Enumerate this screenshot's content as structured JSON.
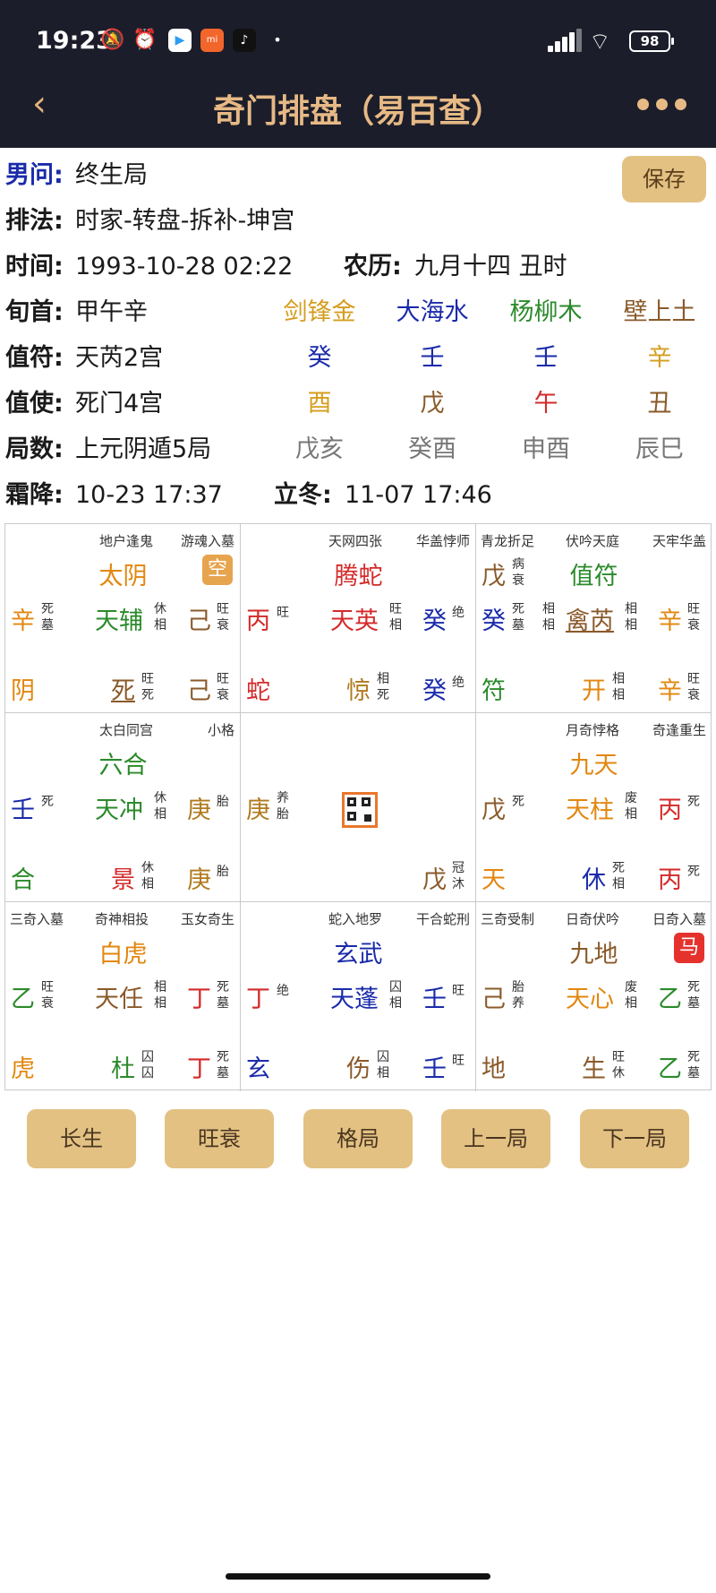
{
  "status_bar": {
    "time": "19:23",
    "battery": "98",
    "app3_glyph": "mi"
  },
  "header": {
    "title": "奇门排盘（易百查）",
    "back_icon": "chevron-left-icon",
    "more_icon": "more-dots-icon"
  },
  "save_label": "保存",
  "info": {
    "gender_label": "男问:",
    "gender_value": "终生局",
    "method_label": "排法:",
    "method_value": "时家-转盘-拆补-坤宫",
    "time_label": "时间:",
    "time_value": "1993-10-28 02:22",
    "lunar_label": "农历:",
    "lunar_value": "九月十四 丑时",
    "xunshou_label": "旬首:",
    "xunshou_value": "甲午辛",
    "nayin": [
      "剑锋金",
      "大海水",
      "杨柳木",
      "壁上土"
    ],
    "zhifu_label": "值符:",
    "zhifu_value": "天芮2宫",
    "zhifu_cols": [
      "癸",
      "壬",
      "壬",
      "辛"
    ],
    "zhishi_label": "值使:",
    "zhishi_value": "死门4宫",
    "zhishi_cols": [
      "酉",
      "戊",
      "午",
      "丑"
    ],
    "jushu_label": "局数:",
    "jushu_value": "上元阴遁5局",
    "jushu_cols": [
      "戊亥",
      "癸酉",
      "申酉",
      "辰巳"
    ],
    "term1_label": "霜降:",
    "term1_value": "10-23 17:37",
    "term2_label": "立冬:",
    "term2_value": "11-07 17:46"
  },
  "palaces": [
    {
      "mtag": "地户逢鬼",
      "rtag": "游魂入墓",
      "god": "太阴",
      "badge": "空",
      "l_stem": "辛",
      "l_s1": "死",
      "l_s2": "墓",
      "star": "天辅",
      "star_s1": "休",
      "star_s2": "相",
      "r_stem": "己",
      "r_s1": "旺",
      "r_s2": "衰",
      "b_god": "阴",
      "door": "死",
      "door_s1": "旺",
      "door_s2": "死",
      "b_stem": "己",
      "b_s1": "旺",
      "b_s2": "衰"
    },
    {
      "mtag": "天网四张",
      "rtag": "华盖悖师",
      "god": "腾蛇",
      "l_stem": "丙",
      "l_s1": "旺",
      "star": "天英",
      "star_s1": "旺",
      "star_s2": "相",
      "r_stem": "癸",
      "r_s1": "绝",
      "b_god": "蛇",
      "door": "惊",
      "door_s1": "相",
      "door_s2": "死",
      "b_stem": "癸",
      "b_s1": "绝"
    },
    {
      "ltag": "青龙折足",
      "mtag": "伏吟天庭",
      "rtag": "天牢华盖",
      "god": "值符",
      "t_stem": "戊",
      "t_s1": "病",
      "t_s2": "衰",
      "l_stem": "癸",
      "l_s1": "死",
      "l_s2": "墓",
      "l_s3": "相",
      "l_s4": "相",
      "star": "禽芮",
      "star_s1": "相",
      "star_s2": "相",
      "r_stem": "辛",
      "r_s1": "旺",
      "r_s2": "衰",
      "b_god": "符",
      "door": "开",
      "door_s1": "相",
      "door_s2": "相",
      "b_stem": "辛",
      "b_s1": "旺",
      "b_s2": "衰"
    },
    {
      "mtag": "太白同宫",
      "rtag": "小格",
      "god": "六合",
      "l_stem": "壬",
      "l_s1": "死",
      "star": "天冲",
      "star_s1": "休",
      "star_s2": "相",
      "r_stem": "庚",
      "r_s1": "胎",
      "b_god": "合",
      "door": "景",
      "door_s1": "休",
      "door_s2": "相",
      "b_stem": "庚",
      "b_s1": "胎"
    },
    {
      "l_stem": "庚",
      "l_s1": "养",
      "l_s2": "胎",
      "b_stem": "戊",
      "b_s1": "冠",
      "b_s2": "沐",
      "qr_icon": "qr-code-icon"
    },
    {
      "mtag": "月奇悖格",
      "rtag": "奇逢重生",
      "god": "九天",
      "l_stem": "戊",
      "l_s1": "死",
      "star": "天柱",
      "star_s1": "废",
      "star_s2": "相",
      "r_stem": "丙",
      "r_s1": "死",
      "b_god": "天",
      "door": "休",
      "door_s1": "死",
      "door_s2": "相",
      "b_stem": "丙",
      "b_s1": "死"
    },
    {
      "ltag": "三奇入墓",
      "mtag": "奇神相投",
      "rtag": "玉女奇生",
      "god": "白虎",
      "l_stem": "乙",
      "l_s1": "旺",
      "l_s2": "衰",
      "star": "天任",
      "star_s1": "相",
      "star_s2": "相",
      "r_stem": "丁",
      "r_s1": "死",
      "r_s2": "墓",
      "b_god": "虎",
      "door": "杜",
      "door_s1": "囚",
      "door_s2": "囚",
      "b_stem": "丁",
      "b_s1": "死",
      "b_s2": "墓"
    },
    {
      "mtag": "蛇入地罗",
      "rtag": "干合蛇刑",
      "god": "玄武",
      "l_stem": "丁",
      "l_s1": "绝",
      "star": "天蓬",
      "star_s1": "囚",
      "star_s2": "相",
      "r_stem": "壬",
      "r_s1": "旺",
      "b_god": "玄",
      "door": "伤",
      "door_s1": "囚",
      "door_s2": "相",
      "b_stem": "壬",
      "b_s1": "旺"
    },
    {
      "ltag": "三奇受制",
      "mtag": "日奇伏吟",
      "rtag": "日奇入墓",
      "god": "九地",
      "badge": "马",
      "l_stem": "己",
      "l_s1": "胎",
      "l_s2": "养",
      "star": "天心",
      "star_s1": "废",
      "star_s2": "相",
      "r_stem": "乙",
      "r_s1": "死",
      "r_s2": "墓",
      "b_god": "地",
      "door": "生",
      "door_s1": "旺",
      "door_s2": "休",
      "b_stem": "乙",
      "b_s1": "死",
      "b_s2": "墓"
    }
  ],
  "buttons": [
    "长生",
    "旺衰",
    "格局",
    "上一局",
    "下一局"
  ]
}
